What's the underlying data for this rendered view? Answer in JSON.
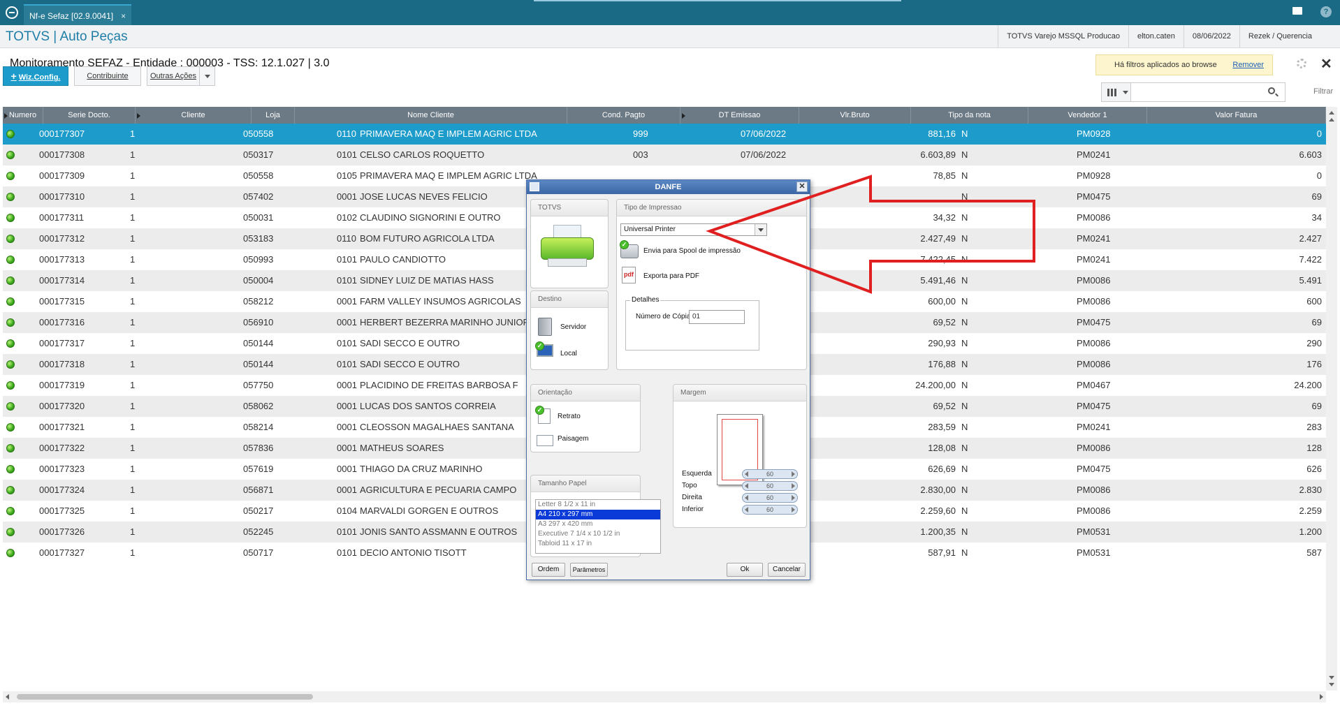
{
  "topbar": {
    "tab_label": "Nf-e Sefaz [02.9.0041]",
    "tab_close": "×"
  },
  "header": {
    "app_title": "TOTVS | Auto Peças",
    "environment": "TOTVS Varejo MSSQL Producao",
    "user": "elton.caten",
    "date": "08/06/2022",
    "branch": "Rezek / Querencia"
  },
  "page": {
    "title": "Monitoramento SEFAZ - Entidade : 000003 - TSS: 12.1.027 | 3.0",
    "filter_notice": "Há filtros aplicados ao browse",
    "remove_label": "Remover",
    "close_glyph": "✕"
  },
  "toolbar": {
    "wizconfig_label": "Wiz.Config.",
    "contribuinte_label": "Contribuinte",
    "outras_acoes_label": "Outras Ações",
    "search_value": "",
    "filter_label": "Filtrar"
  },
  "grid": {
    "columns": [
      "Numero",
      "Serie Docto.",
      "Cliente",
      "Loja",
      "Nome Cliente",
      "Cond. Pagto",
      "DT Emissao",
      "Vlr.Bruto",
      "Tipo da nota",
      "Vendedor 1",
      "Valor Fatura"
    ],
    "selected_row": 0,
    "rows": [
      [
        "000177307",
        "1",
        "050558",
        "0110",
        "PRIMAVERA MAQ E IMPLEM AGRIC LTDA",
        "999",
        "07/06/2022",
        "881,16",
        "N",
        "PM0928",
        "0"
      ],
      [
        "000177308",
        "1",
        "050317",
        "0101",
        "CELSO CARLOS ROQUETTO",
        "003",
        "07/06/2022",
        "6.603,89",
        "N",
        "PM0241",
        "6.603"
      ],
      [
        "000177309",
        "1",
        "050558",
        "0105",
        "PRIMAVERA MAQ E IMPLEM AGRIC LTDA",
        "",
        "",
        "78,85",
        "N",
        "PM0928",
        "0"
      ],
      [
        "000177310",
        "1",
        "057402",
        "0001",
        "JOSE LUCAS NEVES FELICIO",
        "",
        "",
        "",
        "N",
        "PM0475",
        "69"
      ],
      [
        "000177311",
        "1",
        "050031",
        "0102",
        "CLAUDINO SIGNORINI E OUTRO",
        "",
        "",
        "34,32",
        "N",
        "PM0086",
        "34"
      ],
      [
        "000177312",
        "1",
        "053183",
        "0110",
        "BOM FUTURO AGRICOLA LTDA",
        "",
        "",
        "2.427,49",
        "N",
        "PM0241",
        "2.427"
      ],
      [
        "000177313",
        "1",
        "050993",
        "0101",
        "PAULO CANDIOTTO",
        "",
        "",
        "7.422,45",
        "N",
        "PM0241",
        "7.422"
      ],
      [
        "000177314",
        "1",
        "050004",
        "0101",
        "SIDNEY LUIZ DE MATIAS HASS",
        "",
        "",
        "5.491,46",
        "N",
        "PM0086",
        "5.491"
      ],
      [
        "000177315",
        "1",
        "058212",
        "0001",
        "FARM VALLEY INSUMOS AGRICOLAS",
        "",
        "",
        "600,00",
        "N",
        "PM0086",
        "600"
      ],
      [
        "000177316",
        "1",
        "056910",
        "0001",
        "HERBERT BEZERRA MARINHO JUNIOR",
        "",
        "",
        "69,52",
        "N",
        "PM0475",
        "69"
      ],
      [
        "000177317",
        "1",
        "050144",
        "0101",
        "SADI SECCO E OUTRO",
        "",
        "",
        "290,93",
        "N",
        "PM0086",
        "290"
      ],
      [
        "000177318",
        "1",
        "050144",
        "0101",
        "SADI SECCO E OUTRO",
        "",
        "",
        "176,88",
        "N",
        "PM0086",
        "176"
      ],
      [
        "000177319",
        "1",
        "057750",
        "0001",
        "PLACIDINO DE FREITAS BARBOSA F",
        "",
        "",
        "24.200,00",
        "N",
        "PM0467",
        "24.200"
      ],
      [
        "000177320",
        "1",
        "058062",
        "0001",
        "LUCAS DOS SANTOS CORREIA",
        "",
        "",
        "69,52",
        "N",
        "PM0475",
        "69"
      ],
      [
        "000177321",
        "1",
        "058214",
        "0001",
        "CLEOSSON MAGALHAES SANTANA",
        "",
        "",
        "283,59",
        "N",
        "PM0241",
        "283"
      ],
      [
        "000177322",
        "1",
        "057836",
        "0001",
        "MATHEUS SOARES",
        "",
        "",
        "128,08",
        "N",
        "PM0086",
        "128"
      ],
      [
        "000177323",
        "1",
        "057619",
        "0001",
        "THIAGO DA CRUZ MARINHO",
        "",
        "",
        "626,69",
        "N",
        "PM0475",
        "626"
      ],
      [
        "000177324",
        "1",
        "056871",
        "0001",
        "AGRICULTURA E PECUARIA CAMPO",
        "",
        "",
        "2.830,00",
        "N",
        "PM0086",
        "2.830"
      ],
      [
        "000177325",
        "1",
        "050217",
        "0104",
        "MARVALDI GORGEN E OUTROS",
        "",
        "",
        "2.259,60",
        "N",
        "PM0086",
        "2.259"
      ],
      [
        "000177326",
        "1",
        "052245",
        "0101",
        "JONIS SANTO ASSMANN E OUTROS",
        "",
        "",
        "1.200,35",
        "N",
        "PM0531",
        "1.200"
      ],
      [
        "000177327",
        "1",
        "050717",
        "0101",
        "DECIO ANTONIO TISOTT",
        "",
        "",
        "587,91",
        "N",
        "PM0531",
        "587"
      ]
    ]
  },
  "dialog": {
    "title": "DANFE",
    "totvs_label": "TOTVS",
    "destino_label": "Destino",
    "servidor_label": "Servidor",
    "local_label": "Local",
    "tipo_impressao_label": "Tipo de Impressao",
    "printer_value": "Universal Printer",
    "spool_label": "Envia para Spool de impressão",
    "pdf_label": "Exporta para PDF",
    "pdf_icon_text": "pdf",
    "detalhes_label": "Detalhes",
    "copias_label": "Número de Cópias:",
    "copias_value": "01",
    "orientacao_label": "Orientação",
    "retrato_label": "Retrato",
    "paisagem_label": "Paisagem",
    "margem_label": "Margem",
    "margins": [
      {
        "label": "Esquerda",
        "value": "60"
      },
      {
        "label": "Topo",
        "value": "60"
      },
      {
        "label": "Direita",
        "value": "60"
      },
      {
        "label": "Inferior",
        "value": "60"
      }
    ],
    "tamanho_label": "Tamanho Papel",
    "paper_sizes": [
      "Letter 8 1/2 x 11 in",
      "A4 210 x 297 mm",
      "A3 297 x 420 mm",
      "Executive 7 1/4 x 10 1/2 in",
      "Tabloid 11 x 17 in"
    ],
    "paper_selected": 1,
    "ordem_label": "Ordem",
    "parametros_label": "Parâmetros",
    "ok_label": "Ok",
    "cancelar_label": "Cancelar",
    "check_glyph": "✓"
  },
  "colors": {
    "topbar": "#1a6a86",
    "accent": "#1d9ccc",
    "grid_header": "#6c7a86",
    "status_ok": "#3aa61b",
    "arrow": "#e02020"
  },
  "icons": [
    "app-logo-icon",
    "mail-icon",
    "help-icon",
    "gear-icon",
    "close-icon",
    "columns-icon",
    "search-icon",
    "status-green-icon",
    "printer-icon",
    "server-icon",
    "monitor-icon",
    "spool-icon",
    "pdf-icon",
    "portrait-icon",
    "landscape-icon"
  ]
}
